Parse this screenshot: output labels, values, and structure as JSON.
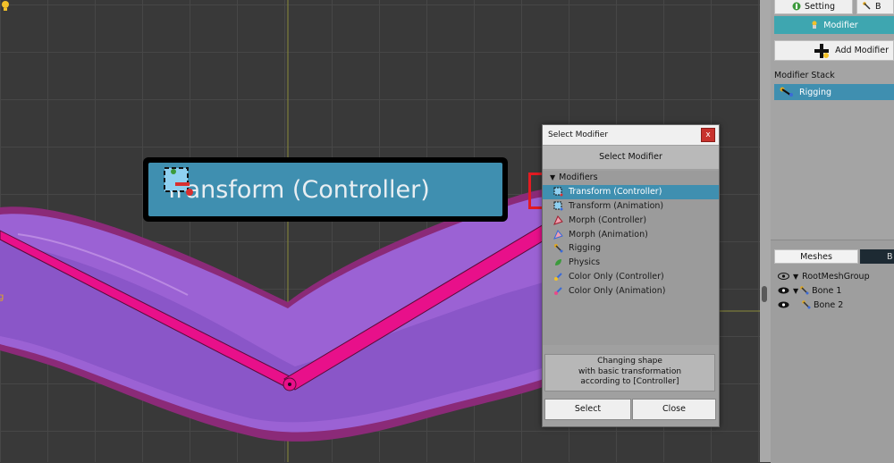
{
  "canvas": {
    "side_label": "g",
    "highlight_label": "Transform (Controller)"
  },
  "dialog": {
    "title": "Select Modifier",
    "close_glyph": "x",
    "header": "Select Modifier",
    "root_label": "Modifiers",
    "items": [
      {
        "label": "Transform (Controller)",
        "icon": "transform-controller-icon"
      },
      {
        "label": "Transform (Animation)",
        "icon": "transform-animation-icon"
      },
      {
        "label": "Morph (Controller)",
        "icon": "morph-controller-icon"
      },
      {
        "label": "Morph (Animation)",
        "icon": "morph-animation-icon"
      },
      {
        "label": "Rigging",
        "icon": "rigging-icon"
      },
      {
        "label": "Physics",
        "icon": "physics-icon"
      },
      {
        "label": "Color Only (Controller)",
        "icon": "color-controller-icon"
      },
      {
        "label": "Color Only (Animation)",
        "icon": "color-animation-icon"
      }
    ],
    "description_lines": [
      "Changing shape",
      "with basic transformation",
      "according to [Controller]"
    ],
    "select_label": "Select",
    "close_label": "Close"
  },
  "panel": {
    "setting_label": "Setting",
    "b_label": "B",
    "modifier_tab": "Modifier",
    "add_modifier": "Add Modifier",
    "modifier_stack_label": "Modifier Stack",
    "stack_items": [
      "Rigging"
    ],
    "meshes_tab": "Meshes",
    "bones_tab": "B",
    "hierarchy": [
      {
        "label": "RootMeshGroup",
        "level": 0
      },
      {
        "label": "Bone 1",
        "level": 1
      },
      {
        "label": "Bone 2",
        "level": 2
      }
    ]
  },
  "colors": {
    "accent": "#3f8fb0",
    "highlight_red": "#e21b22",
    "mesh_fill": "#9b5fd0",
    "bone_pink": "#e8108a"
  }
}
